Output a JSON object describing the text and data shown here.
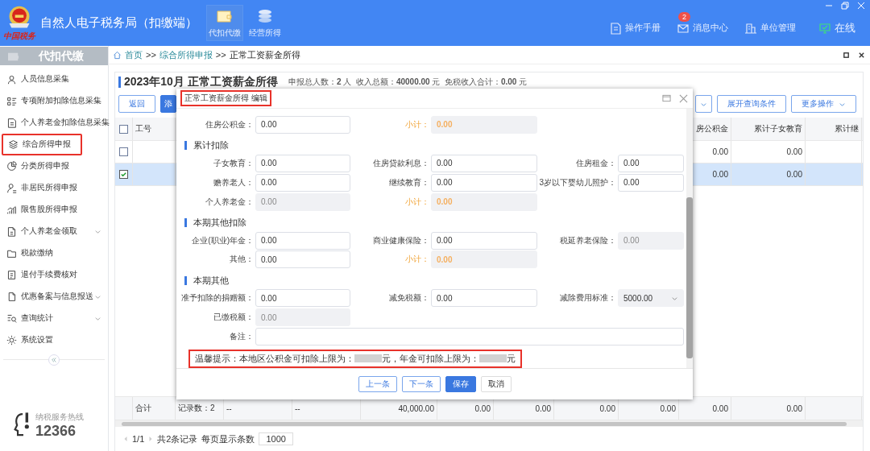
{
  "header": {
    "logo_caption": "中国税务",
    "title": "自然人电子税务局（扣缴端）",
    "tabs": [
      {
        "label": "代扣代缴",
        "selected": true
      },
      {
        "label": "经营所得",
        "selected": false
      }
    ],
    "actions": [
      {
        "label": "操作手册"
      },
      {
        "label": "消息中心",
        "badge": "2"
      },
      {
        "label": "单位管理"
      },
      {
        "label": "在线",
        "kind": "status"
      }
    ]
  },
  "sidebar": {
    "title": "代扣代缴",
    "items": [
      {
        "label": "人员信息采集",
        "selected": false,
        "expandable": false
      },
      {
        "label": "专项附加扣除信息采集",
        "selected": false,
        "expandable": false
      },
      {
        "label": "个人养老金扣除信息采集",
        "selected": false,
        "expandable": false
      },
      {
        "label": "综合所得申报",
        "selected": true,
        "expandable": false
      },
      {
        "label": "分类所得申报",
        "selected": false,
        "expandable": false
      },
      {
        "label": "非居民所得申报",
        "selected": false,
        "expandable": false
      },
      {
        "label": "限售股所得申报",
        "selected": false,
        "expandable": false
      },
      {
        "label": "个人养老金领取",
        "selected": false,
        "expandable": true
      },
      {
        "label": "税款缴纳",
        "selected": false,
        "expandable": false
      },
      {
        "label": "退付手续费核对",
        "selected": false,
        "expandable": false
      },
      {
        "label": "优惠备案与信息报送",
        "selected": false,
        "expandable": true
      },
      {
        "label": "查询统计",
        "selected": false,
        "expandable": true
      },
      {
        "label": "系统设置",
        "selected": false,
        "expandable": false
      }
    ],
    "hotline_label": "纳税服务热线",
    "hotline_number": "12366"
  },
  "breadcrumb": [
    {
      "label": "首页",
      "kind": "link"
    },
    {
      "label": ">>",
      "kind": "sep"
    },
    {
      "label": "综合所得申报",
      "kind": "link"
    },
    {
      "label": ">>",
      "kind": "sep"
    },
    {
      "label": "正常工资薪金所得",
      "kind": "current"
    }
  ],
  "page": {
    "title": "2023年10月 正常工资薪金所得",
    "summary": "申报总人数：**2** 人  收入总额：**40000.00** 元  免税收入合计：**0.00** 元",
    "left_buttons": [
      {
        "label": "返回",
        "kind": "default"
      },
      {
        "label": "添",
        "kind": "primary"
      }
    ],
    "right_buttons": [
      {
        "kind": "dropdown"
      },
      {
        "label": "展开查询条件",
        "kind": "default"
      },
      {
        "label": "更多操作",
        "kind": "dropdown"
      }
    ]
  },
  "table": {
    "columns": [
      {
        "kind": "checkbox",
        "checked": false
      },
      {
        "label": "工号"
      },
      {},
      {},
      {},
      {},
      {},
      {},
      {},
      {},
      {
        "label": "房公积金"
      },
      {
        "label": "累计子女教育"
      },
      {
        "label": "累计继"
      }
    ],
    "rows": [
      {
        "selected": false,
        "checked": false,
        "cells": [
          null,
          null,
          null,
          null,
          null,
          null,
          null,
          null,
          null,
          null,
          "0.00",
          "0.00",
          null
        ]
      },
      {
        "selected": true,
        "checked": true,
        "cells": [
          null,
          null,
          null,
          null,
          null,
          null,
          null,
          null,
          null,
          null,
          "0.00",
          "0.00",
          null
        ]
      }
    ],
    "footer": [
      "合计",
      "记录数：2",
      "--",
      "--",
      "40,000.00",
      "0.00",
      "0.00",
      "0.00",
      "0.00",
      "0.00",
      "0.00"
    ]
  },
  "pagination": {
    "pages": "1/1",
    "total": "共2条记录",
    "page_size_label": "每页显示条数",
    "page_size": "1000"
  },
  "dialog": {
    "title": "正常工资薪金所得 编辑",
    "sections": [
      {
        "rows": [
          [
            {
              "label": "住房公积金：",
              "value": "0.00",
              "kind": "input"
            },
            {
              "label": "小计：",
              "value": "0.00",
              "kind": "subtotal"
            }
          ]
        ]
      },
      {
        "title": "累计扣除",
        "rows": [
          [
            {
              "label": "子女教育：",
              "value": "0.00",
              "kind": "input"
            },
            {
              "label": "住房贷款利息：",
              "value": "0.00",
              "kind": "input"
            },
            {
              "label": "住房租金：",
              "value": "0.00",
              "kind": "input"
            }
          ],
          [
            {
              "label": "赡养老人：",
              "value": "0.00",
              "kind": "input"
            },
            {
              "label": "继续教育：",
              "value": "0.00",
              "kind": "input"
            },
            {
              "label": "3岁以下婴幼儿照护：",
              "value": "0.00",
              "kind": "input"
            }
          ],
          [
            {
              "label": "个人养老金：",
              "value": "0.00",
              "kind": "readonly"
            },
            {
              "label": "小计：",
              "value": "0.00",
              "kind": "subtotal"
            }
          ]
        ]
      },
      {
        "title": "本期其他扣除",
        "rows": [
          [
            {
              "label": "企业(职业)年金：",
              "value": "0.00",
              "kind": "input"
            },
            {
              "label": "商业健康保险：",
              "value": "0.00",
              "kind": "input"
            },
            {
              "label": "税延养老保险：",
              "value": "0.00",
              "kind": "readonly"
            }
          ],
          [
            {
              "label": "其他：",
              "value": "0.00",
              "kind": "input"
            },
            {
              "label": "小计：",
              "value": "0.00",
              "kind": "subtotal"
            }
          ]
        ]
      },
      {
        "title": "本期其他",
        "rows": [
          [
            {
              "label": "准予扣除的捐赠额：",
              "value": "0.00",
              "kind": "input"
            },
            {
              "label": "减免税额：",
              "value": "0.00",
              "kind": "input"
            },
            {
              "label": "减除费用标准：",
              "value": "5000.00",
              "kind": "select"
            }
          ],
          [
            {
              "label": "已缴税额：",
              "value": "0.00",
              "kind": "readonly"
            }
          ],
          [
            {
              "label": "备注：",
              "kind": "wide"
            }
          ]
        ]
      }
    ],
    "tip": [
      "温馨提示：本地区公积金可扣除上限为：",
      "元，年金可扣除上限为：",
      "元"
    ],
    "buttons": [
      {
        "label": "上一条",
        "kind": "outline"
      },
      {
        "label": "下一条",
        "kind": "outline"
      },
      {
        "label": "保存",
        "kind": "primary"
      },
      {
        "label": "取消",
        "kind": "default"
      }
    ]
  }
}
